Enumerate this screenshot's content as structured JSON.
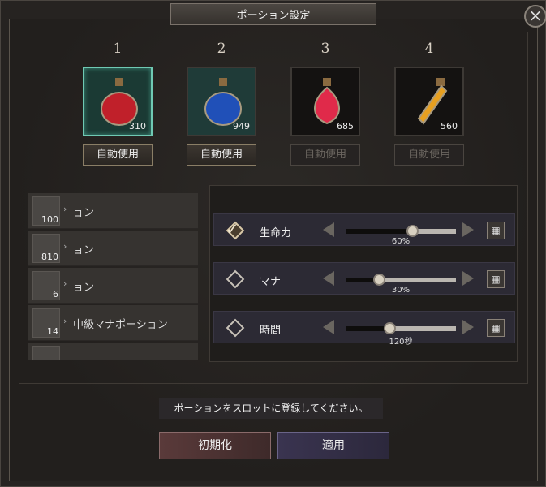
{
  "window": {
    "title": "ポーション設定",
    "close": "×"
  },
  "slots": [
    {
      "number": "1",
      "count": "310",
      "auto": "自動使用",
      "auto_enabled": true,
      "color": "#c0202a"
    },
    {
      "number": "2",
      "count": "949",
      "auto": "自動使用",
      "auto_enabled": true,
      "color": "#2050b8"
    },
    {
      "number": "3",
      "count": "685",
      "auto": "自動使用",
      "auto_enabled": false,
      "color": "#e02a4a"
    },
    {
      "number": "4",
      "count": "560",
      "auto": "自動使用",
      "auto_enabled": false,
      "color": "#e8a020"
    }
  ],
  "potion_list": [
    {
      "count": "100",
      "name": "ョン"
    },
    {
      "count": "810",
      "name": "ョン"
    },
    {
      "count": "6",
      "name": "ョン"
    },
    {
      "count": "14",
      "name": "中級マナポーション"
    }
  ],
  "settings": [
    {
      "label": "生命力",
      "checked": true,
      "value": "60%",
      "level": 0.6
    },
    {
      "label": "マナ",
      "checked": false,
      "value": "30%",
      "level": 0.3
    },
    {
      "label": "時間",
      "checked": false,
      "value": "120秒",
      "level": 0.4
    }
  ],
  "message": "ポーションをスロットに登録してください。",
  "buttons": {
    "reset": "初期化",
    "apply": "適用"
  }
}
